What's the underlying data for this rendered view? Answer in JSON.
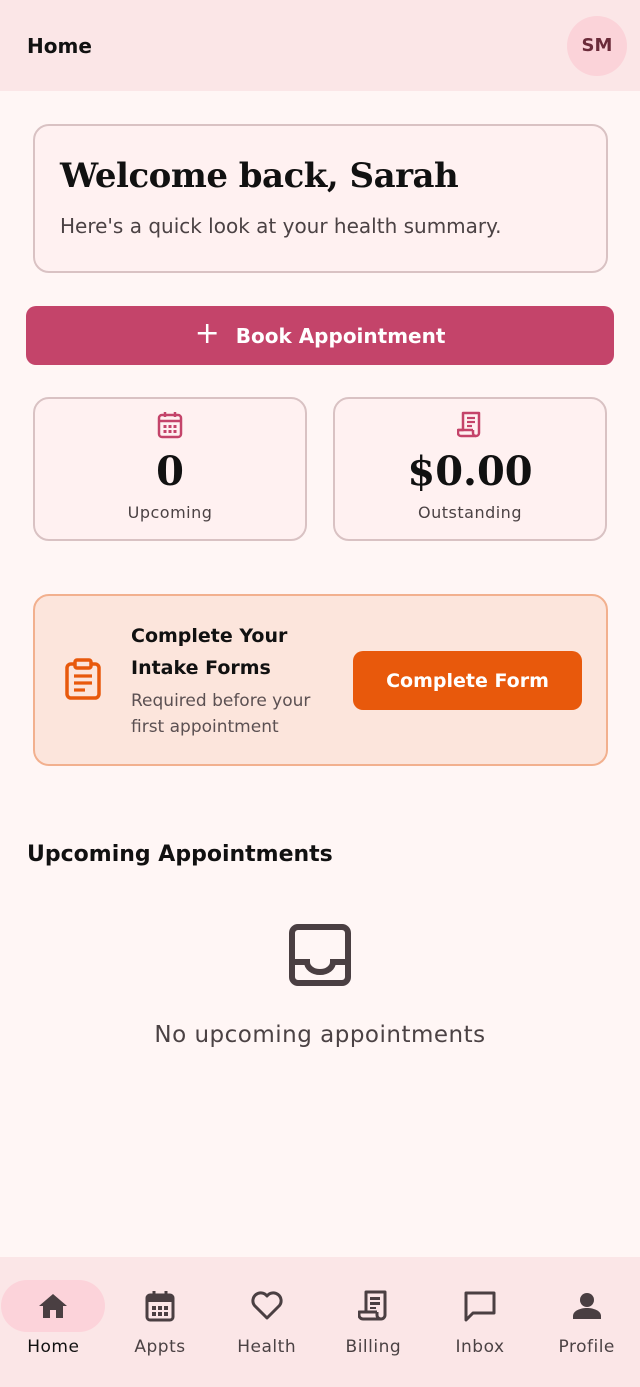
{
  "header": {
    "title": "Home",
    "avatar_initials": "SM"
  },
  "welcome": {
    "title": "Welcome back, Sarah",
    "subtitle": "Here's a quick look at your health summary."
  },
  "book_button": {
    "icon": "plus-icon",
    "label": "Book Appointment"
  },
  "stats": [
    {
      "icon": "calendar-icon",
      "value": "0",
      "label": "Upcoming"
    },
    {
      "icon": "receipt-icon",
      "value": "$0.00",
      "label": "Outstanding"
    }
  ],
  "intake": {
    "icon": "clipboard-icon",
    "title": "Complete Your Intake Forms",
    "subtitle": "Required before your first appointment",
    "button_label": "Complete Form"
  },
  "appointments": {
    "section_title": "Upcoming Appointments",
    "empty_icon": "inbox-icon",
    "empty_text": "No upcoming appointments"
  },
  "nav": {
    "active": "Home",
    "items": [
      {
        "icon": "home-icon",
        "label": "Home"
      },
      {
        "icon": "calendar-icon",
        "label": "Appts"
      },
      {
        "icon": "heart-icon",
        "label": "Health"
      },
      {
        "icon": "receipt-icon",
        "label": "Billing"
      },
      {
        "icon": "chat-icon",
        "label": "Inbox"
      },
      {
        "icon": "person-icon",
        "label": "Profile"
      }
    ]
  },
  "colors": {
    "primary": "#c4446a",
    "accent_orange": "#e8590c",
    "background": "#fff6f5",
    "header_bg": "#fbe6e7",
    "active_pill": "#fcd3da"
  }
}
